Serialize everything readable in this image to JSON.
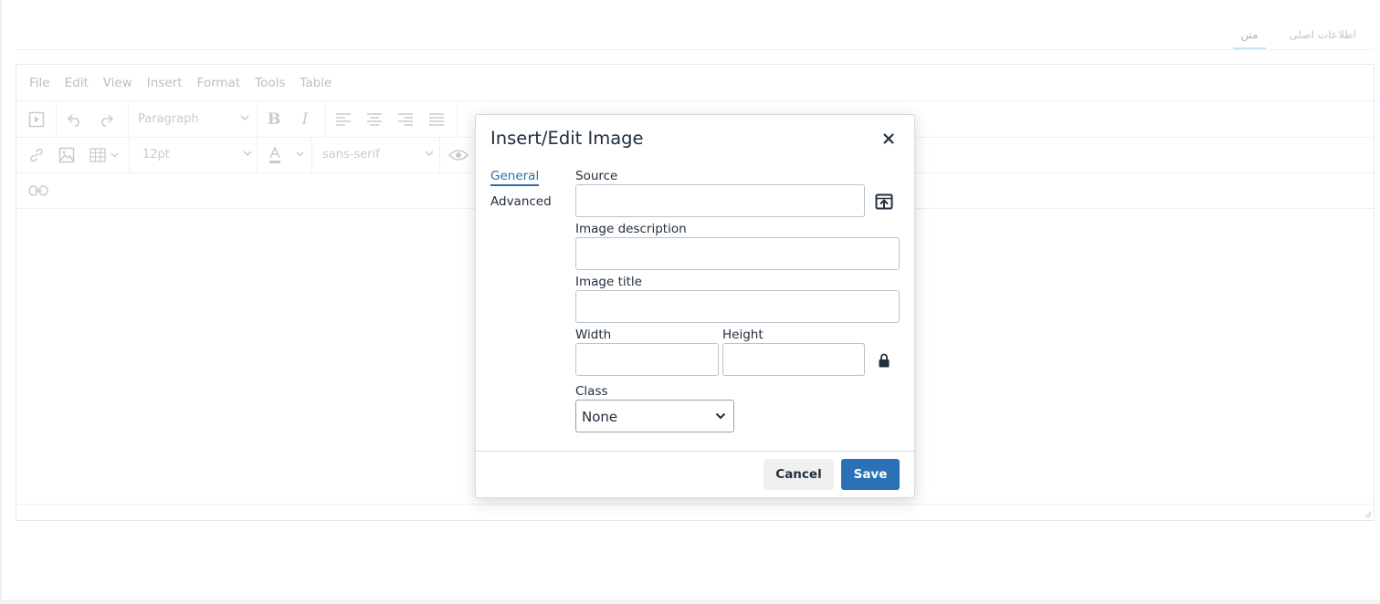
{
  "tabs": [
    {
      "label": "اطلاعات اصلی",
      "active": false
    },
    {
      "label": "متن",
      "active": true
    }
  ],
  "menubar": [
    "File",
    "Edit",
    "View",
    "Insert",
    "Format",
    "Tools",
    "Table"
  ],
  "toolbar": {
    "block_format": "Paragraph",
    "font_size": "12pt",
    "font_family": "sans-serif",
    "bold_glyph": "B",
    "italic_glyph": "I"
  },
  "dialog": {
    "title": "Insert/Edit Image",
    "nav": {
      "general": "General",
      "advanced": "Advanced"
    },
    "source_label": "Source",
    "source_value": "",
    "description_label": "Image description",
    "description_value": "",
    "title_label": "Image title",
    "title_value": "",
    "width_label": "Width",
    "width_value": "",
    "height_label": "Height",
    "height_value": "",
    "class_label": "Class",
    "class_value": "None",
    "cancel_label": "Cancel",
    "save_label": "Save"
  },
  "colors": {
    "accent": "#2a72b5",
    "text": "#222f3e",
    "disabled": "#c5cbd1"
  },
  "icons": [
    "preview-icon",
    "undo-icon",
    "redo-icon",
    "align-left-icon",
    "align-center-icon",
    "align-right-icon",
    "justify-icon",
    "link-icon",
    "image-icon",
    "table-icon",
    "text-color-icon",
    "eye-icon",
    "unlink-icon",
    "close-icon",
    "browse-upload-icon",
    "lock-icon",
    "chevron-down-icon"
  ]
}
